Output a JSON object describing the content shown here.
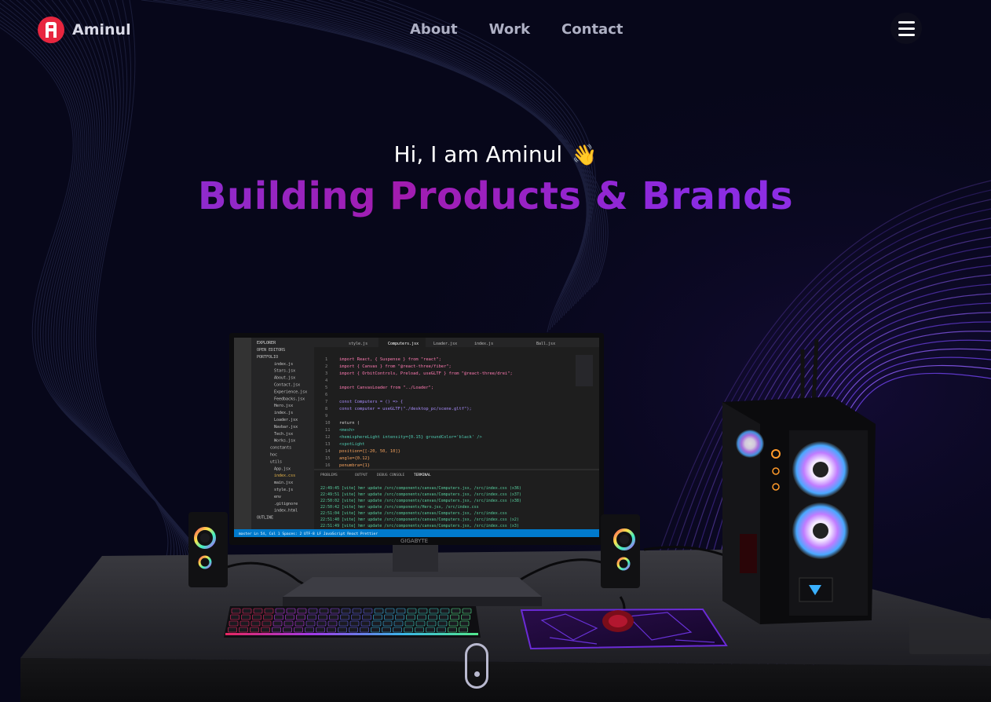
{
  "nav": {
    "brand": "Aminul",
    "links": [
      {
        "label": "About"
      },
      {
        "label": "Work"
      },
      {
        "label": "Contact"
      }
    ],
    "menu_icon": "hamburger-menu-icon"
  },
  "hero": {
    "greeting": "Hi, I am Aminul",
    "wave_icon": "👋",
    "headline": "Building Products & Brands"
  },
  "monitor": {
    "brand": "GIGABYTE",
    "editor_tabs": [
      {
        "label": "style.js"
      },
      {
        "label": "Computers.jsx"
      },
      {
        "label": "Loader.jsx"
      },
      {
        "label": "index.js"
      },
      {
        "label": "Ball.jsx"
      }
    ],
    "explorer_title": "EXPLORER",
    "explorer_items": [
      "OPEN EDITORS",
      "PORTFOLIO",
      "index.js",
      "Stars.jsx",
      "About.jsx",
      "Contact.jsx",
      "Experience.jsx",
      "Feedbacks.jsx",
      "Hero.jsx",
      "index.js",
      "Loader.jsx",
      "Navbar.jsx",
      "Tech.jsx",
      "Works.jsx",
      "constants",
      "hoc",
      "utils",
      "App.jsx",
      "index.css",
      "main.jsx",
      "style.js",
      "env",
      ".gitignore",
      "index.html",
      "OUTLINE"
    ],
    "code_lines": [
      "import React, { Suspense } from \"react\";",
      "import { Canvas } from \"@react-three/fiber\";",
      "import { OrbitControls, Preload, useGLTF } from \"@react-three/drei\";",
      "",
      "import CanvasLoader from \"../Loader\";",
      "",
      "const Computers = () => {",
      "  const computer = useGLTF(\"./desktop_pc/scene.gltf\");",
      "",
      "  return (",
      "    <mesh>",
      "      <hemisphereLight intensity={0.15} groundColor='black' />",
      "      <spotLight",
      "        position={[-20, 50, 10]}",
      "        angle={0.12}",
      "        penumbra={1}"
    ],
    "panel_tabs": [
      "PROBLEMS",
      "OUTPUT",
      "DEBUG CONSOLE",
      "TERMINAL"
    ],
    "terminal_lines": [
      "22:49:45 [vite] hmr update /src/components/canvas/Computers.jsx, /src/index.css (x36)",
      "22:49:51 [vite] hmr update /src/components/canvas/Computers.jsx, /src/index.css (x37)",
      "22:50:02 [vite] hmr update /src/components/canvas/Computers.jsx, /src/index.css (x38)",
      "22:50:42 [vite] hmr update /src/components/Hero.jsx, /src/index.css",
      "22:51:04 [vite] hmr update /src/components/canvas/Computers.jsx, /src/index.css",
      "22:51:40 [vite] hmr update /src/components/canvas/Computers.jsx, /src/index.css (x2)",
      "22:51:49 [vite] hmr update /src/components/canvas/Computers.jsx, /src/index.css (x3)"
    ],
    "status_bar": "master   Ln 54, Col 1   Spaces: 2   UTF-8   LF   JavaScript React   Prettier"
  },
  "colors": {
    "accent": "#915eff",
    "background": "#07071a",
    "logo": "#e8263f"
  },
  "scroll_indicator": "scroll-mouse-icon"
}
